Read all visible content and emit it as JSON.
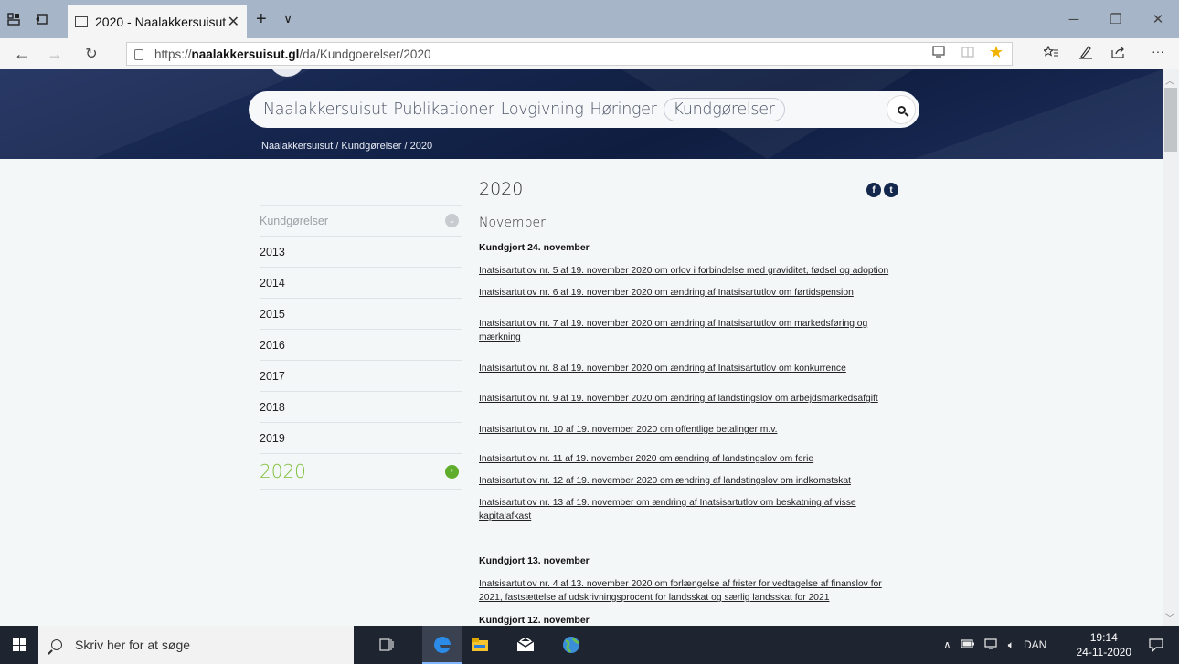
{
  "browser": {
    "tab_title": "2020 - Naalakkersuisut",
    "url_prefix": "https://",
    "url_domain": "naalakkersuisut.gl",
    "url_path": "/da/Kundgoerelser/2020"
  },
  "site": {
    "nav": [
      "Naalakkersuisut",
      "Publikationer",
      "Lovgivning",
      "Høringer",
      "Kundgørelser"
    ],
    "breadcrumb": "Naalakkersuisut / Kundgørelser / 2020"
  },
  "sidebar": {
    "header": "Kundgørelser",
    "years": [
      "2013",
      "2014",
      "2015",
      "2016",
      "2017",
      "2018",
      "2019"
    ],
    "current": "2020"
  },
  "content": {
    "title": "2020",
    "month": "November",
    "section1": "Kundgjort 24. november",
    "links1": [
      "Inatsisartutlov nr. 5 af 19. november 2020 om orlov i forbindelse med graviditet, fødsel og adoption",
      "Inatsisartutlov nr. 6 af 19. november 2020 om ændring af Inatsisartutlov om førtidspension",
      "Inatsisartutlov nr. 7 af 19. november 2020 om ændring af Inatsisartutlov om markedsføring og mærkning",
      "Inatsisartutlov nr. 8 af 19. november 2020 om ændring af Inatsisartutlov om konkurrence",
      "Inatsisartutlov nr. 9 af 19. november 2020 om ændring af landstingslov om arbejdsmarkedsafgift",
      "Inatsisartutlov nr. 10 af 19. november 2020 om offentlige betalinger m.v.",
      "Inatsisartutlov nr. 11 af 19. november 2020 om ændring af landstingslov om ferie",
      "Inatsisartutlov nr. 12 af 19. november 2020 om ændring af landstingslov om indkomstskat",
      "Inatsisartutlov nr. 13 af 19. november om ændring af Inatsisartutlov om beskatning af visse kapitalafkast"
    ],
    "section2": "Kundgjort 13. november",
    "links2": [
      "Inatsisartutlov nr. 4 af 13. november 2020 om forlængelse af frister for vedtagelse af finanslov for 2021, fastsættelse af udskrivningsprocent for landsskat og særlig landsskat for 2021"
    ],
    "section3": "Kundgjort 12. november"
  },
  "taskbar": {
    "search_placeholder": "Skriv her for at søge",
    "language": "DAN",
    "time": "19:14",
    "date": "24-11-2020"
  }
}
